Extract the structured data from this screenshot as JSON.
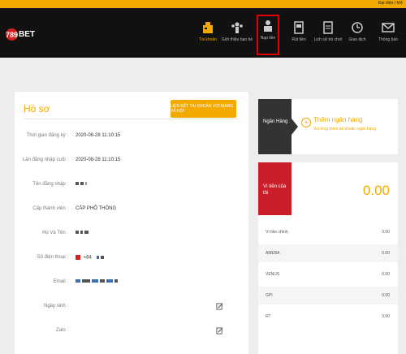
{
  "topbar": {
    "text": "Đại điện / Mở"
  },
  "logo": {
    "badge": "789",
    "text": "BET"
  },
  "nav": [
    {
      "label": "Tài khoản",
      "icon": "account-icon"
    },
    {
      "label": "Giới thiệu bạn bè",
      "icon": "referral-icon"
    },
    {
      "label": "Nạp tiền",
      "icon": "deposit-icon"
    },
    {
      "label": "Rút tiền",
      "icon": "withdraw-icon"
    },
    {
      "label": "Lịch sử trò chơi",
      "icon": "history-icon"
    },
    {
      "label": "Giao dịch",
      "icon": "transaction-icon"
    },
    {
      "label": "Thông báo",
      "icon": "mail-icon"
    }
  ],
  "profile": {
    "title": "Hồ sơ",
    "link_button": "LIÊN KẾT TÀI KHOẢN VỚI MẠNG XÃ HỘI",
    "rows": [
      {
        "label": "Thời gian đăng ký :",
        "value": "2020-08-28 11:10:15"
      },
      {
        "label": "Lần đăng nhập cuối :",
        "value": "2020-08-28 11:10:15"
      },
      {
        "label": "Tên đăng nhập :",
        "value": ""
      },
      {
        "label": "Cấp thành viên :",
        "value": "CẤP PHỔ THÔNG"
      },
      {
        "label": "Họ Và Tên :",
        "value": ""
      },
      {
        "label": "Số điện thoại :",
        "value": "+84"
      },
      {
        "label": "Email :",
        "value": ""
      },
      {
        "label": "Ngày sinh :",
        "value": ""
      },
      {
        "label": "Zalo :",
        "value": ""
      }
    ]
  },
  "bank": {
    "header": "Ngân Hàng",
    "add_title": "Thêm ngân hàng",
    "add_sub": "Vui lòng thêm tài khoản ngân hàng"
  },
  "wallet": {
    "header": "Ví tiền của tôi",
    "total": "0.00",
    "rows": [
      {
        "name": "Ví tiền chính",
        "value": "0.00"
      },
      {
        "name": "AMEBA",
        "value": "0.00"
      },
      {
        "name": "VENUS",
        "value": "0.00"
      },
      {
        "name": "GPI",
        "value": "0.00"
      },
      {
        "name": "RT",
        "value": "0.00"
      }
    ]
  },
  "colors": {
    "accent": "#f2a900",
    "nav_bg": "#111111",
    "wallet_red": "#cc1d2b",
    "highlight": "#e00000"
  }
}
